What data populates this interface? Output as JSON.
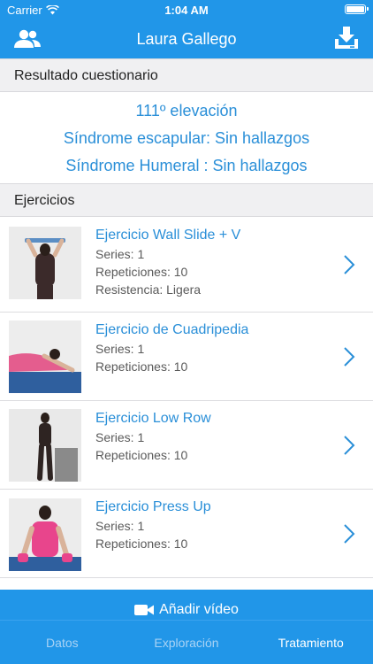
{
  "status_bar": {
    "carrier": "Carrier",
    "time": "1:04 AM"
  },
  "nav": {
    "title": "Laura Gallego",
    "left_icon": "users-icon",
    "right_icon": "download-icon"
  },
  "questionnaire": {
    "header": "Resultado cuestionario",
    "results": [
      "111º elevación",
      "Síndrome escapular: Sin hallazgos",
      "Síndrome Humeral : Sin hallazgos"
    ]
  },
  "exercises_section": {
    "header": "Ejercicios",
    "items": [
      {
        "title": "Ejercicio Wall Slide + V",
        "lines": [
          "Series: 1",
          "Repeticiones: 10",
          "Resistencia: Ligera"
        ]
      },
      {
        "title": "Ejercicio de Cuadripedia",
        "lines": [
          "Series: 1",
          "Repeticiones: 10"
        ]
      },
      {
        "title": "Ejercicio Low Row",
        "lines": [
          "Series: 1",
          "Repeticiones: 10"
        ]
      },
      {
        "title": "Ejercicio Press Up",
        "lines": [
          "Series: 1",
          "Repeticiones: 10"
        ]
      }
    ]
  },
  "add_video": {
    "label": "Añadir vídeo",
    "icon": "video-camera-icon"
  },
  "tabs": [
    {
      "label": "Datos",
      "active": false
    },
    {
      "label": "Exploración",
      "active": false
    },
    {
      "label": "Tratamiento",
      "active": true
    }
  ],
  "colors": {
    "brand": "#2196e8",
    "link": "#2a8fd8"
  }
}
